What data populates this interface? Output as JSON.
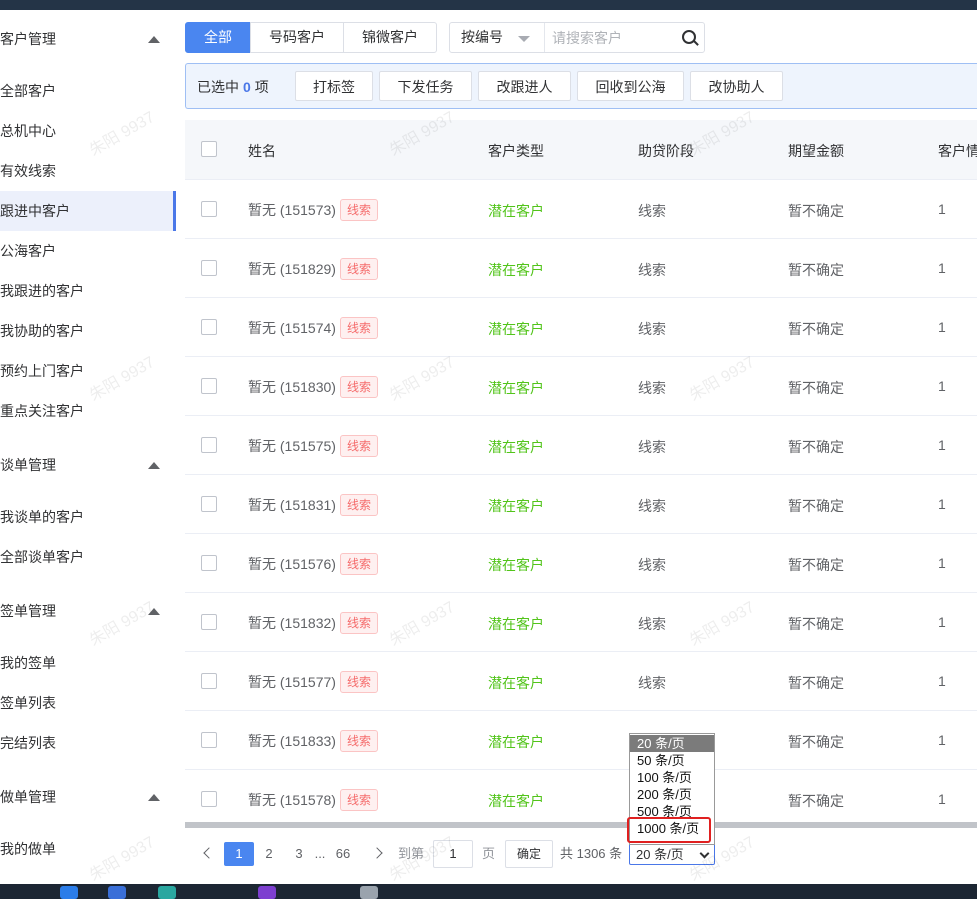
{
  "sidebar": {
    "sections": [
      {
        "title": "客户管理",
        "items": [
          "全部客户",
          "总机中心",
          "有效线索",
          "跟进中客户",
          "公海客户",
          "我跟进的客户",
          "我协助的客户",
          "预约上门客户",
          "重点关注客户"
        ]
      },
      {
        "title": "谈单管理",
        "items": [
          "我谈单的客户",
          "全部谈单客户"
        ]
      },
      {
        "title": "签单管理",
        "items": [
          "我的签单",
          "签单列表",
          "完结列表"
        ]
      },
      {
        "title": "做单管理",
        "items": [
          "我的做单"
        ]
      }
    ],
    "active_item": "跟进中客户"
  },
  "tabs": [
    "全部",
    "号码客户",
    "锦微客户"
  ],
  "search": {
    "field": "按编号",
    "placeholder": "请搜索客户"
  },
  "selection": {
    "prefix": "已选中",
    "count": "0",
    "suffix": "项",
    "actions": [
      "打标签",
      "下发任务",
      "改跟进人",
      "回收到公海",
      "改协助人"
    ]
  },
  "table": {
    "columns": [
      "姓名",
      "客户类型",
      "助贷阶段",
      "期望金额",
      "客户情"
    ],
    "rows": [
      {
        "name": "暂无 (151573)",
        "tag": "线索",
        "type": "潜在客户",
        "stage": "线索",
        "amount": "暂不确定",
        "level": "1"
      },
      {
        "name": "暂无 (151829)",
        "tag": "线索",
        "type": "潜在客户",
        "stage": "线索",
        "amount": "暂不确定",
        "level": "1"
      },
      {
        "name": "暂无 (151574)",
        "tag": "线索",
        "type": "潜在客户",
        "stage": "线索",
        "amount": "暂不确定",
        "level": "1"
      },
      {
        "name": "暂无 (151830)",
        "tag": "线索",
        "type": "潜在客户",
        "stage": "线索",
        "amount": "暂不确定",
        "level": "1"
      },
      {
        "name": "暂无 (151575)",
        "tag": "线索",
        "type": "潜在客户",
        "stage": "线索",
        "amount": "暂不确定",
        "level": "1"
      },
      {
        "name": "暂无 (151831)",
        "tag": "线索",
        "type": "潜在客户",
        "stage": "线索",
        "amount": "暂不确定",
        "level": "1"
      },
      {
        "name": "暂无 (151576)",
        "tag": "线索",
        "type": "潜在客户",
        "stage": "线索",
        "amount": "暂不确定",
        "level": "1"
      },
      {
        "name": "暂无 (151832)",
        "tag": "线索",
        "type": "潜在客户",
        "stage": "线索",
        "amount": "暂不确定",
        "level": "1"
      },
      {
        "name": "暂无 (151577)",
        "tag": "线索",
        "type": "潜在客户",
        "stage": "线索",
        "amount": "暂不确定",
        "level": "1"
      },
      {
        "name": "暂无 (151833)",
        "tag": "线索",
        "type": "潜在客户",
        "stage": "",
        "amount": "暂不确定",
        "level": "1"
      },
      {
        "name": "暂无 (151578)",
        "tag": "线索",
        "type": "潜在客户",
        "stage": "",
        "amount": "暂不确定",
        "level": "1"
      }
    ]
  },
  "pagination": {
    "pages": [
      "1",
      "2",
      "3",
      "...",
      "66"
    ],
    "current": "1",
    "goto_prefix": "到第",
    "goto_value": "1",
    "goto_suffix": "页",
    "confirm": "确定",
    "total": "共 1306 条",
    "page_size": "20 条/页",
    "page_size_options": [
      "20 条/页",
      "50 条/页",
      "100 条/页",
      "200 条/页",
      "500 条/页",
      "1000 条/页"
    ]
  },
  "watermark": "朱阳 9937",
  "colors": {
    "primary": "#4a86f0",
    "customer_type": "#52c41a",
    "tag_red": "#f56c6c",
    "highlight_box": "#e02020"
  }
}
